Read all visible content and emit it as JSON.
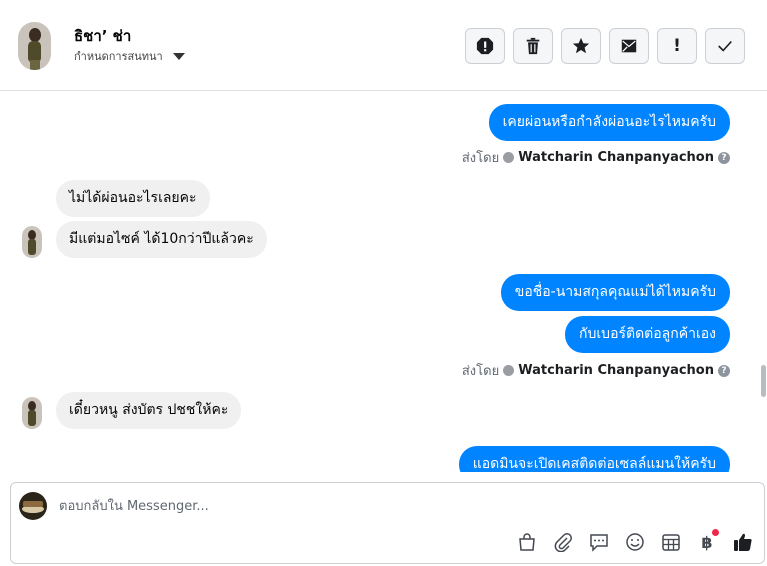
{
  "header": {
    "contact_name": "ธิชา’ ช่า",
    "sub_label": "กำหนดการสนทนา"
  },
  "toolbar": {
    "buttons": [
      {
        "name": "spam-icon",
        "label": ""
      },
      {
        "name": "trash-icon",
        "label": ""
      },
      {
        "name": "star-icon",
        "label": ""
      },
      {
        "name": "mark-unread-icon",
        "label": ""
      },
      {
        "name": "priority-icon",
        "label": "!"
      },
      {
        "name": "done-icon",
        "label": ""
      }
    ]
  },
  "messages": [
    {
      "dir": "out",
      "text": "เคยผ่อนหรือกำลังผ่อนอะไรไหมครับ"
    },
    {
      "dir": "meta",
      "prefix": "ส่งโดย",
      "sender": "Watcharin Chanpanyachon"
    },
    {
      "dir": "in",
      "text": "ไม่ได้ผ่อนอะไรเลยคะ"
    },
    {
      "dir": "in",
      "text": "มีแต่มอไซค์ ได้10กว่าปีแล้วคะ"
    },
    {
      "dir": "out",
      "text": "ขอชื่อ-นามสกุลคุณแม่ได้ไหมครับ"
    },
    {
      "dir": "out",
      "text": "กับเบอร์ติดต่อลูกค้าเอง"
    },
    {
      "dir": "meta",
      "prefix": "ส่งโดย",
      "sender": "Watcharin Chanpanyachon"
    },
    {
      "dir": "in",
      "text": "เดี๋ยวหนู ส่งบัตร ปชชให้คะ"
    },
    {
      "dir": "out",
      "text": "แอดมินจะเปิดเคสติดต่อเซลล์แมนให้ครับ"
    }
  ],
  "composer": {
    "placeholder": "ตอบกลับใน Messenger...",
    "baht_symbol": "฿"
  },
  "colors": {
    "accent": "#0084ff",
    "incoming_bubble": "#f0f0f0",
    "notification_dot": "#f02849"
  }
}
